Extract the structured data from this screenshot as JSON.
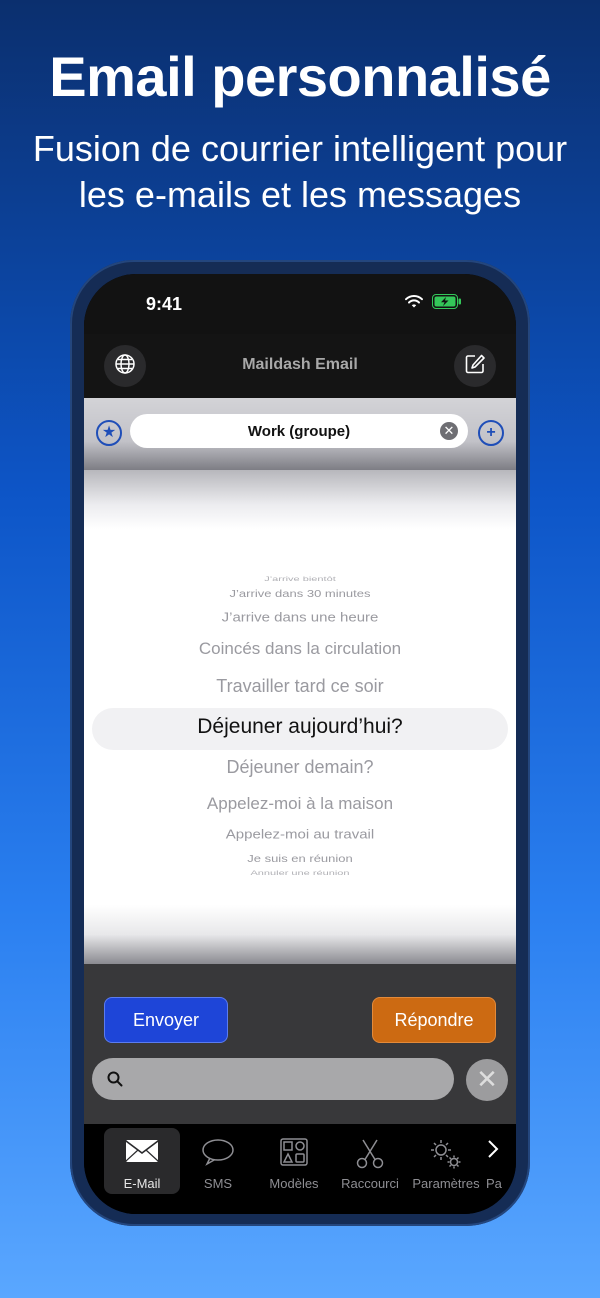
{
  "promo": {
    "title": "Email personnalisé",
    "subtitle_line1": "Fusion de courrier intelligent pour",
    "subtitle_line2": "les e-mails et les messages"
  },
  "status_bar": {
    "time": "9:41",
    "icons": [
      "wifi-icon",
      "battery-charging-icon"
    ]
  },
  "nav": {
    "title": "Maildash Email",
    "left_icon": "globe-icon",
    "right_icon": "compose-icon"
  },
  "group_selector": {
    "value": "Work (groupe)",
    "left_icon": "star-icon",
    "right_icon": "add-icon",
    "clear_icon": "clear-icon"
  },
  "picker": {
    "items": [
      "J’arrive bientôt",
      "J’arrive dans 30 minutes",
      "J’arrive dans une heure",
      "Coincés dans la circulation",
      "Travailler tard ce soir",
      "Déjeuner aujourd’hui?",
      "Déjeuner demain?",
      "Appelez-moi à la maison",
      "Appelez-moi au travail",
      "Je suis en réunion",
      "Annuler une réunion"
    ],
    "selected": "Déjeuner aujourd’hui?"
  },
  "actions": {
    "send_label": "Envoyer",
    "reply_label": "Répondre"
  },
  "search": {
    "placeholder": "",
    "icon": "search-icon",
    "clear_icon": "close-icon"
  },
  "tabs": [
    {
      "label": "E-Mail",
      "icon": "envelope-icon",
      "active": true
    },
    {
      "label": "SMS",
      "icon": "speech-bubble-icon",
      "active": false
    },
    {
      "label": "Modèles",
      "icon": "templates-icon",
      "active": false
    },
    {
      "label": "Raccourci",
      "icon": "scissors-icon",
      "active": false
    },
    {
      "label": "Paramètres",
      "icon": "gears-icon",
      "active": false
    },
    {
      "label": "Pa",
      "icon": "chevron-right-icon",
      "active": false
    }
  ],
  "colors": {
    "send": "#1e45d8",
    "reply": "#cc6a12",
    "accent_blue": "#1f4eb8",
    "battery": "#34c759"
  }
}
